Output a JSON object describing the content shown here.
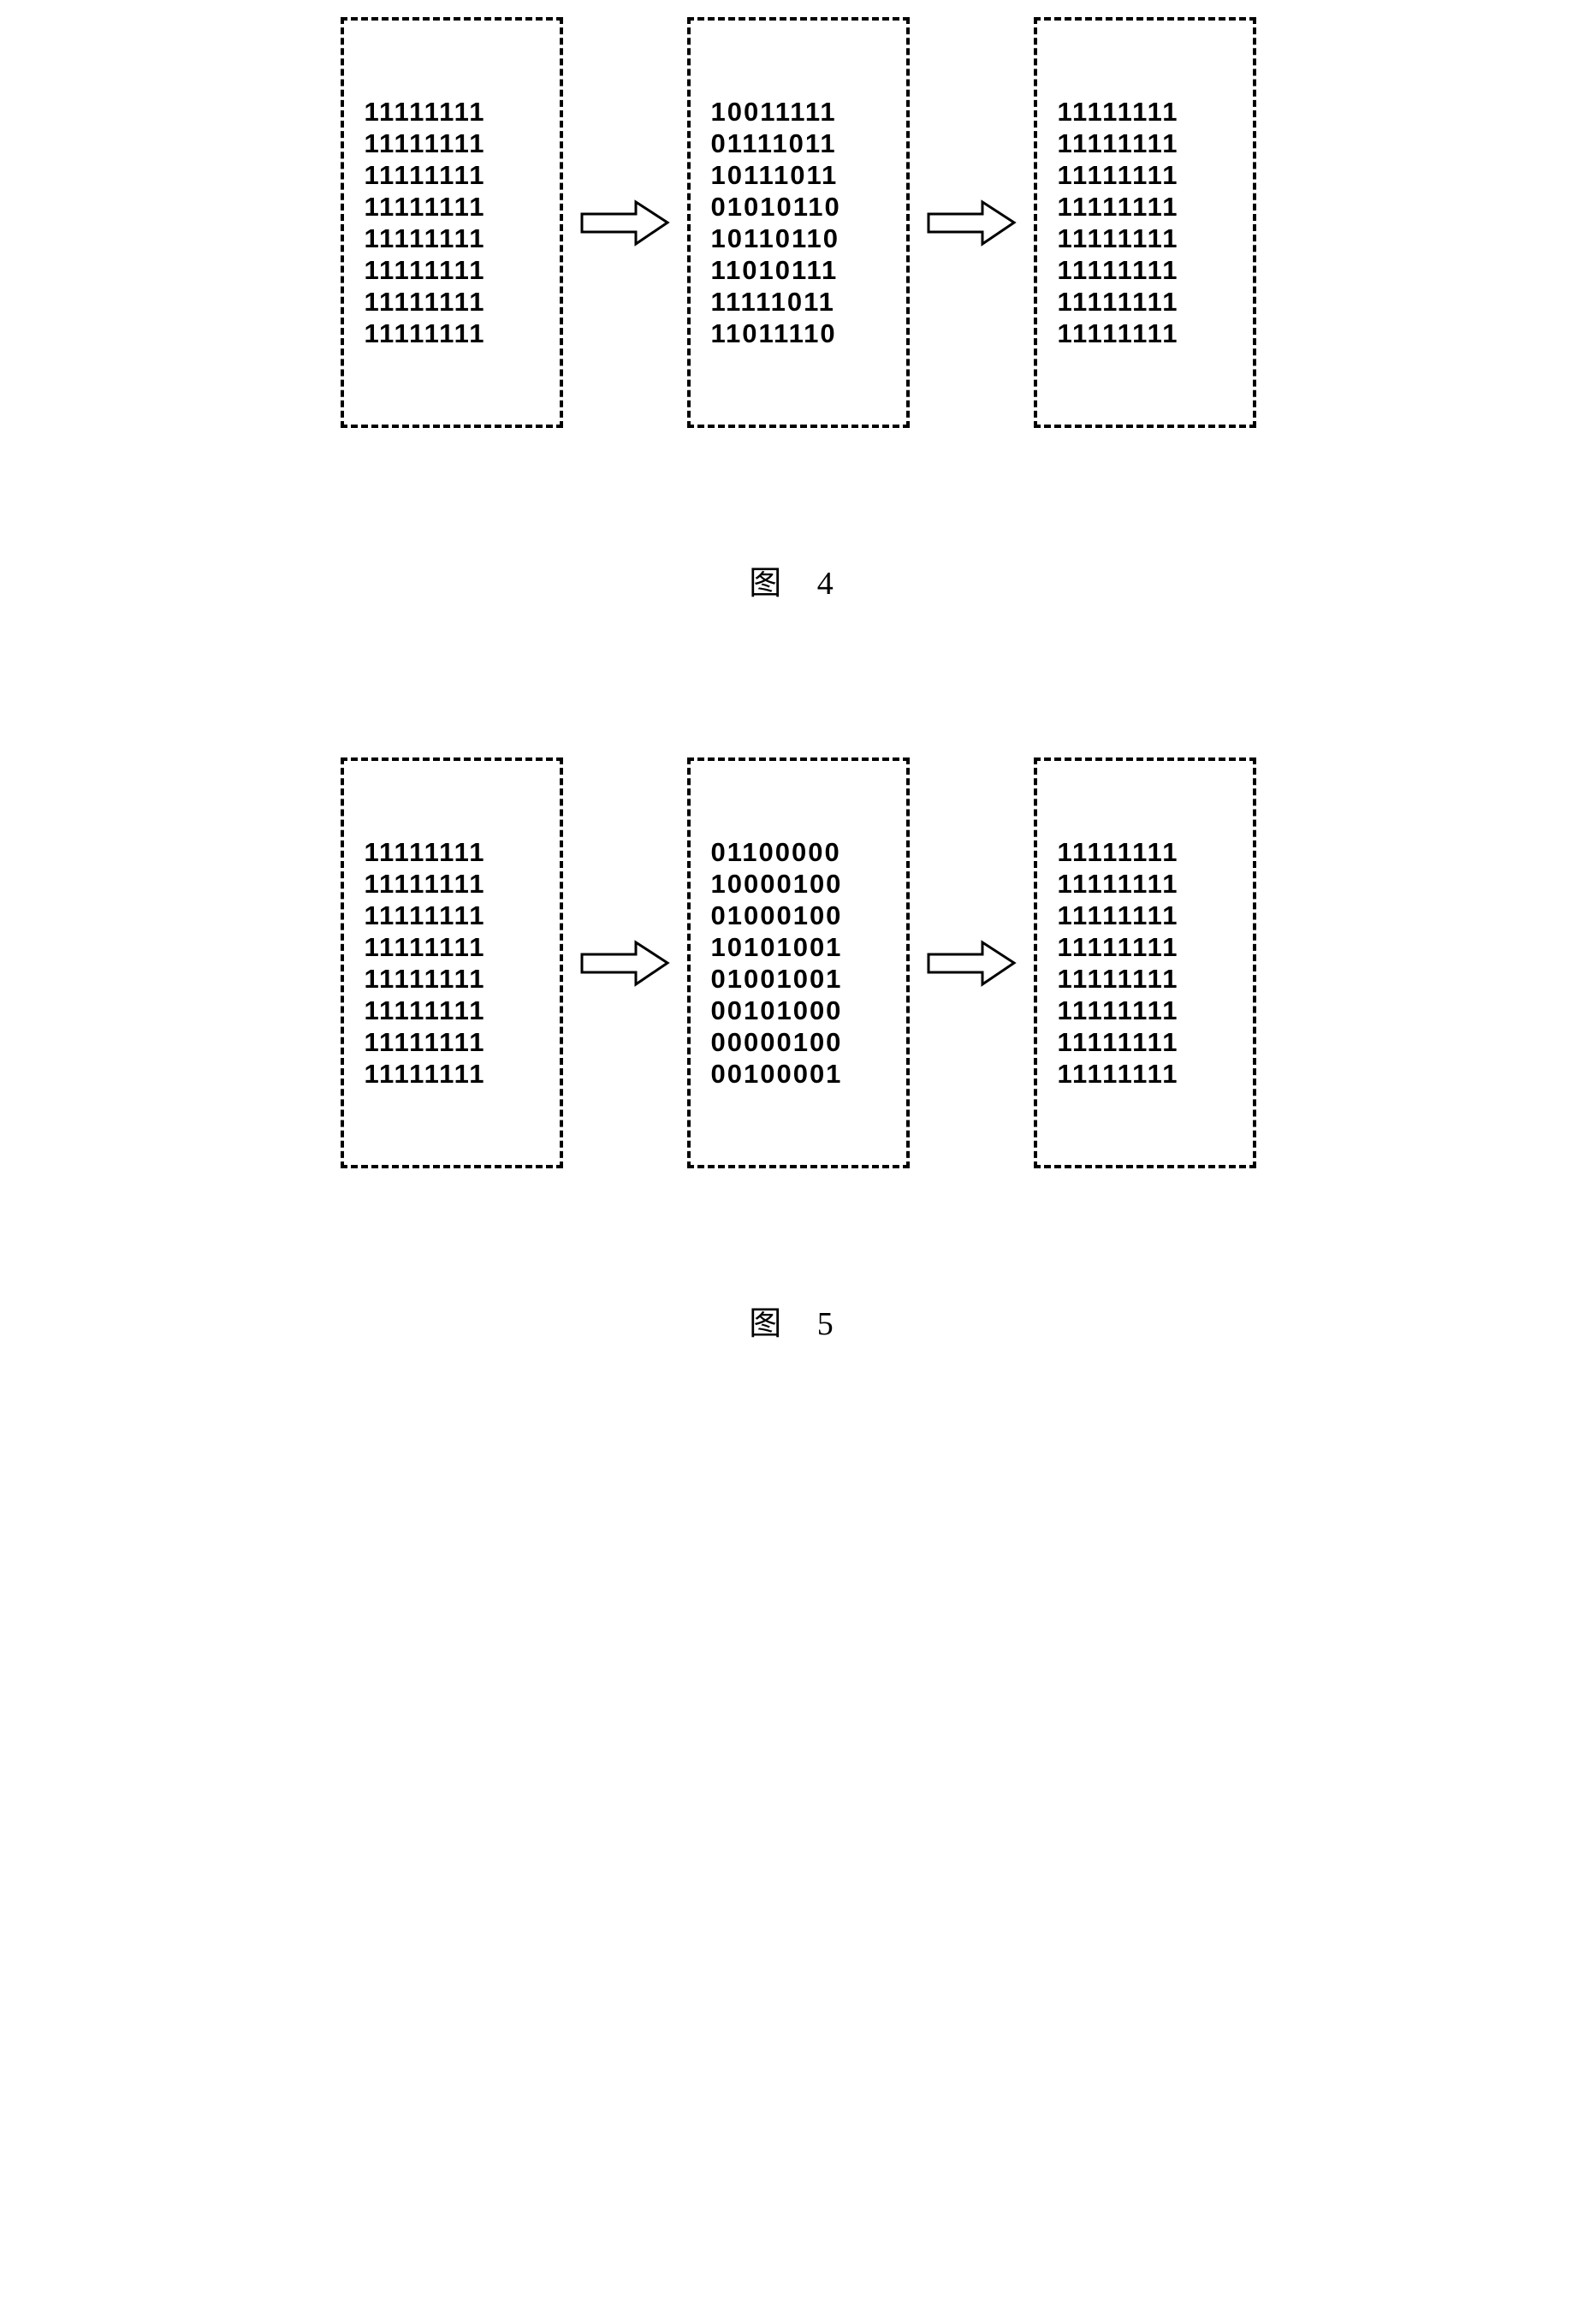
{
  "figures": [
    {
      "caption": "图  4",
      "boxes": [
        {
          "lines": [
            "11111111",
            "11111111",
            "11111111",
            "11111111",
            "11111111",
            "11111111",
            "11111111",
            "11111111"
          ]
        },
        {
          "lines": [
            "10011111",
            "01111011",
            "10111011",
            "01010110",
            "10110110",
            "11010111",
            "11111011",
            "11011110"
          ]
        },
        {
          "lines": [
            "11111111",
            "11111111",
            "11111111",
            "11111111",
            "11111111",
            "11111111",
            "11111111",
            "11111111"
          ]
        }
      ]
    },
    {
      "caption": "图  5",
      "boxes": [
        {
          "lines": [
            "11111111",
            "11111111",
            "11111111",
            "11111111",
            "11111111",
            "11111111",
            "11111111",
            "11111111"
          ]
        },
        {
          "lines": [
            "01100000",
            "10000100",
            "01000100",
            "10101001",
            "01001001",
            "00101000",
            "00000100",
            "00100001"
          ]
        },
        {
          "lines": [
            "11111111",
            "11111111",
            "11111111",
            "11111111",
            "11111111",
            "11111111",
            "11111111",
            "11111111"
          ]
        }
      ]
    }
  ]
}
